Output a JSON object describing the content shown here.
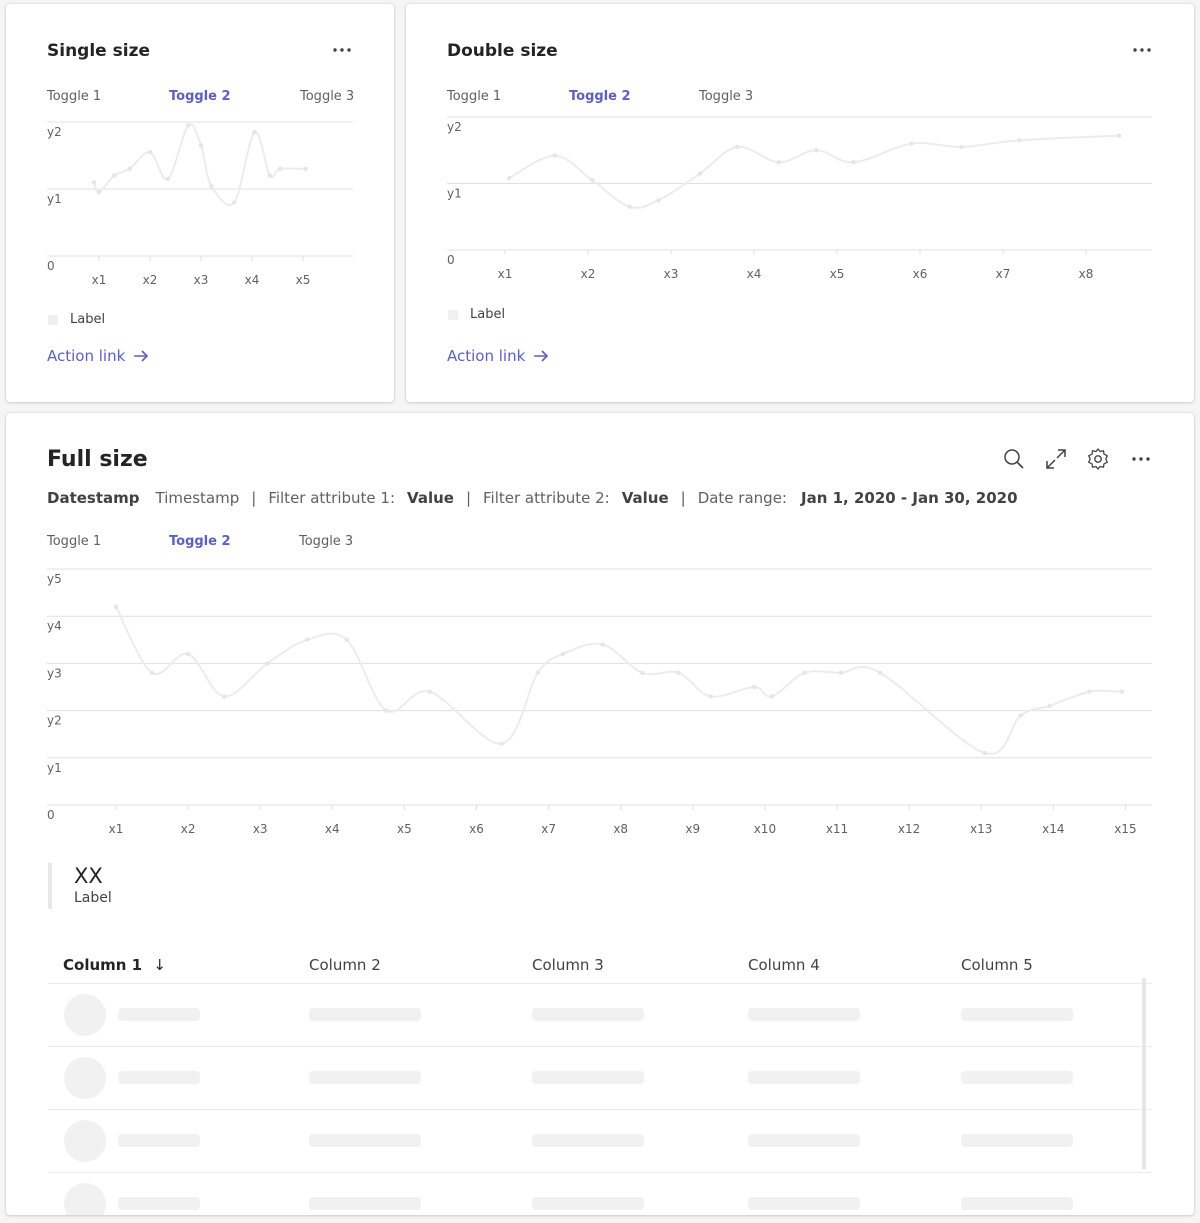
{
  "cards": {
    "single": {
      "title": "Single size",
      "toggles": [
        "Toggle 1",
        "Toggle 2",
        "Toggle 3"
      ],
      "active_toggle": 1,
      "legend_label": "Label",
      "action_link": "Action link"
    },
    "double": {
      "title": "Double size",
      "toggles": [
        "Toggle 1",
        "Toggle 2",
        "Toggle 3"
      ],
      "active_toggle": 1,
      "legend_label": "Label",
      "action_link": "Action link"
    },
    "full": {
      "title": "Full size",
      "filters": {
        "datestamp": "Datestamp",
        "timestamp": "Timestamp",
        "separator": "|",
        "filter1_label": "Filter attribute 1:",
        "filter1_value": "Value",
        "filter2_label": "Filter attribute 2:",
        "filter2_value": "Value",
        "date_range_label": "Date range:",
        "date_range_value": "Jan 1, 2020 - Jan 30, 2020"
      },
      "toggles": [
        "Toggle 1",
        "Toggle 2",
        "Toggle 3"
      ],
      "active_toggle": 1,
      "kpi": {
        "value": "XX",
        "label": "Label"
      },
      "table": {
        "columns": [
          "Column 1",
          "Column 2",
          "Column 3",
          "Column 4",
          "Column 5"
        ],
        "sort_indicator": "↓",
        "row_count": 4
      }
    }
  },
  "icons": {
    "more": "more-horizontal-icon",
    "search": "search-icon",
    "expand": "expand-icon",
    "settings": "gear-icon",
    "arrow": "arrow-right-icon"
  },
  "colors": {
    "accent": "#5b5fc7",
    "line": "#ececec",
    "grid": "#e0e0e0"
  },
  "chart_data": [
    {
      "type": "line",
      "yticks": [
        "0",
        "y1",
        "y2"
      ],
      "categories": [
        "x1",
        "x2",
        "x3",
        "x4",
        "x5"
      ],
      "ylim": [
        0,
        2
      ],
      "x": [
        0.9,
        1.0,
        1.3,
        1.6,
        2.0,
        2.35,
        2.75,
        3.0,
        3.2,
        3.65,
        4.05,
        4.35,
        4.55,
        5.05
      ],
      "values": [
        1.1,
        0.95,
        1.2,
        1.3,
        1.55,
        1.15,
        1.95,
        1.65,
        1.05,
        0.8,
        1.85,
        1.2,
        1.3,
        1.3
      ]
    },
    {
      "type": "line",
      "yticks": [
        "0",
        "y1",
        "y2"
      ],
      "categories": [
        "x1",
        "x2",
        "x3",
        "x4",
        "x5",
        "x6",
        "x7",
        "x8"
      ],
      "ylim": [
        0,
        2
      ],
      "x": [
        1.05,
        1.6,
        2.05,
        2.5,
        2.85,
        3.35,
        3.8,
        4.3,
        4.75,
        5.2,
        5.9,
        6.5,
        7.2,
        8.4
      ],
      "values": [
        1.08,
        1.42,
        1.05,
        0.65,
        0.75,
        1.15,
        1.55,
        1.32,
        1.5,
        1.32,
        1.6,
        1.55,
        1.65,
        1.72
      ]
    },
    {
      "type": "line",
      "yticks": [
        "0",
        "y1",
        "y2",
        "y3",
        "y4",
        "y5"
      ],
      "categories": [
        "x1",
        "x2",
        "x3",
        "x4",
        "x5",
        "x6",
        "x7",
        "x8",
        "x9",
        "x10",
        "x11",
        "x12",
        "x13",
        "x14",
        "x15"
      ],
      "ylim": [
        0,
        5
      ],
      "x": [
        1.0,
        1.5,
        2.0,
        2.5,
        3.1,
        3.65,
        4.2,
        4.75,
        5.35,
        6.35,
        6.85,
        7.2,
        7.75,
        8.3,
        8.8,
        9.25,
        9.85,
        10.1,
        10.55,
        11.05,
        11.6,
        13.05,
        13.55,
        13.95,
        14.5,
        14.95
      ],
      "values": [
        4.2,
        2.8,
        3.2,
        2.3,
        3.0,
        3.5,
        3.5,
        2.0,
        2.4,
        1.3,
        2.8,
        3.2,
        3.4,
        2.8,
        2.8,
        2.3,
        2.5,
        2.3,
        2.8,
        2.8,
        2.8,
        1.1,
        1.9,
        2.1,
        2.4,
        2.4
      ]
    }
  ]
}
